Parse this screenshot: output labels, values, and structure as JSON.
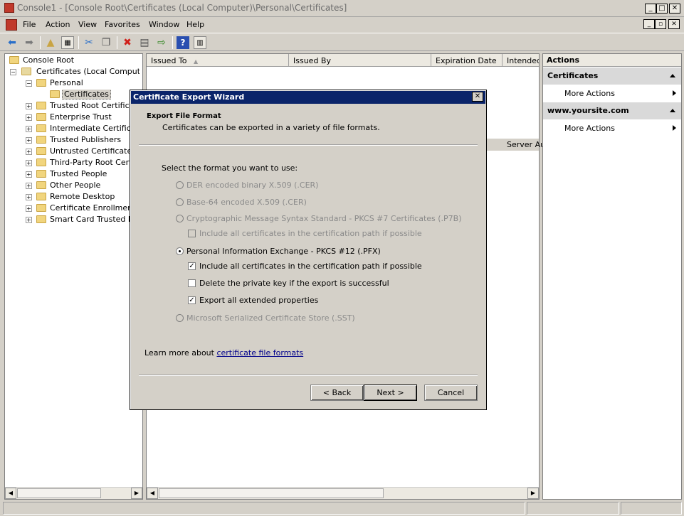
{
  "window": {
    "title": "Console1 - [Console Root\\Certificates (Local Computer)\\Personal\\Certificates]",
    "min": "_",
    "max": "□",
    "close": "✕"
  },
  "menu": {
    "items": [
      "File",
      "Action",
      "View",
      "Favorites",
      "Window",
      "Help"
    ],
    "mdi": [
      "_",
      "▫",
      "✕"
    ]
  },
  "toolbar": {
    "icons": [
      "back-arrow-icon",
      "forward-arrow-icon",
      "up-folder-icon",
      "show-hide-tree-icon",
      "cut-icon",
      "copy-icon",
      "delete-icon",
      "properties-icon",
      "export-list-icon",
      "help-icon",
      "show-hide-action-pane-icon"
    ]
  },
  "tree": {
    "items": [
      {
        "label": "Console Root"
      },
      {
        "label": "Certificates (Local Computer)",
        "expander": "−"
      },
      {
        "label": "Personal",
        "expander": "−"
      },
      {
        "label": "Certificates"
      },
      {
        "label": "Trusted Root Certification Authorities",
        "expander": "+"
      },
      {
        "label": "Enterprise Trust",
        "expander": "+"
      },
      {
        "label": "Intermediate Certification Authorities",
        "expander": "+"
      },
      {
        "label": "Trusted Publishers",
        "expander": "+"
      },
      {
        "label": "Untrusted Certificates",
        "expander": "+"
      },
      {
        "label": "Third-Party Root Certification Authorities",
        "expander": "+"
      },
      {
        "label": "Trusted People",
        "expander": "+"
      },
      {
        "label": "Other People",
        "expander": "+"
      },
      {
        "label": "Remote Desktop",
        "expander": "+"
      },
      {
        "label": "Certificate Enrollment Requests",
        "expander": "+"
      },
      {
        "label": "Smart Card Trusted Roots",
        "expander": "+"
      }
    ]
  },
  "list": {
    "columns": [
      "Issued To",
      "Issued By",
      "Expiration Date",
      "Intended Purposes"
    ],
    "sort_glyph": "▲",
    "row_partial_purpose": "Server Au"
  },
  "actions": {
    "title": "Actions",
    "sections": [
      {
        "header": "Certificates",
        "item": "More Actions"
      },
      {
        "header": "www.yoursite.com",
        "item": "More Actions"
      }
    ]
  },
  "dialog": {
    "title": "Certificate Export Wizard",
    "close": "✕",
    "heading": "Export File Format",
    "subheading": "Certificates can be exported in a variety of file formats.",
    "prompt": "Select the format you want to use:",
    "options": {
      "der": "DER encoded binary X.509 (.CER)",
      "base64": "Base-64 encoded X.509 (.CER)",
      "pkcs7": "Cryptographic Message Syntax Standard - PKCS #7 Certificates (.P7B)",
      "pkcs7_include": "Include all certificates in the certification path if possible",
      "pfx": "Personal Information Exchange - PKCS #12 (.PFX)",
      "pfx_include": "Include all certificates in the certification path if possible",
      "pfx_delete": "Delete the private key if the export is successful",
      "pfx_export_ext": "Export all extended properties",
      "sst": "Microsoft Serialized Certificate Store (.SST)"
    },
    "learn_prefix": "Learn more about ",
    "learn_link": "certificate file formats",
    "back": "< Back",
    "next": "Next >",
    "cancel": "Cancel",
    "check_glyph": "✓"
  }
}
